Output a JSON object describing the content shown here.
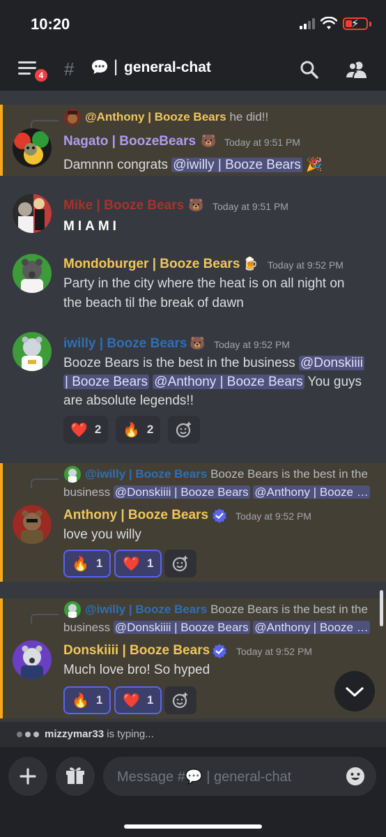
{
  "status_bar": {
    "time": "10:20"
  },
  "header": {
    "badge_count": "4",
    "pipe": "|",
    "channel_name": "general-chat"
  },
  "messages": [
    {
      "reply": {
        "author": "@Anthony | Booze Bears",
        "text": "he did!!"
      },
      "author": "Nagato | BoozeBears",
      "author_color": "#b09cf0",
      "timestamp": "Today at 9:51 PM",
      "body": {
        "before": "Damnnn congrats ",
        "mention": "@iwilly | Booze Bears",
        "after": " 🎉"
      }
    },
    {
      "author": "Mike | Booze Bears",
      "author_color": "#a7332b",
      "timestamp": "Today at 9:51 PM",
      "body": "MIAMI"
    },
    {
      "author": "Mondoburger | Booze Bears",
      "author_color": "#f1c75c",
      "timestamp": "Today at 9:52 PM",
      "body_lines": [
        "Party in the city where the heat is on all night on",
        "the beach til the break of dawn"
      ]
    },
    {
      "author": "iwilly | Booze Bears",
      "author_color": "#2f6fb5",
      "timestamp": "Today at 9:52 PM",
      "line1": {
        "text": "Booze Bears is the best in the business ",
        "mention": "@Donskiiii"
      },
      "line2": {
        "mention1": "| Booze Bears",
        "mention2": "@Anthony | Booze Bears",
        "after": " You guys"
      },
      "line3": "are absolute legends!!",
      "reactions": [
        {
          "emoji": "❤️",
          "count": "2"
        },
        {
          "emoji": "🔥",
          "count": "2"
        }
      ]
    },
    {
      "reply": {
        "author": "@iwilly | Booze Bears",
        "text": "Booze Bears is the best in the",
        "line2_before": "business ",
        "m1": "@Donskiiii | Booze Bears",
        "m2": "@Anthony | Booze …"
      },
      "author": "Anthony | Booze Bears",
      "author_color": "#f1c75c",
      "timestamp": "Today at 9:52 PM",
      "body": "love you willy",
      "reactions": [
        {
          "emoji": "🔥",
          "count": "1"
        },
        {
          "emoji": "❤️",
          "count": "1"
        }
      ]
    },
    {
      "reply": {
        "author": "@iwilly | Booze Bears",
        "text": "Booze Bears is the best in the",
        "line2_before": "business ",
        "m1": "@Donskiiii | Booze Bears",
        "m2": "@Anthony | Booze …"
      },
      "author": "Donskiiii | Booze Bears",
      "author_color": "#f1c75c",
      "timestamp": "Today at 9:52 PM",
      "body": "Much love bro! So hyped",
      "reactions": [
        {
          "emoji": "🔥",
          "count": "1"
        },
        {
          "emoji": "❤️",
          "count": "1"
        }
      ]
    }
  ],
  "typing": {
    "user": "mizzymar33",
    "text": " is typing..."
  },
  "input": {
    "placeholder_before": "Message #",
    "placeholder_after": " | general-chat"
  },
  "colors": {
    "accent": "#faa81a",
    "mention_bg": "#4e517a",
    "verified": "#5865f2"
  }
}
